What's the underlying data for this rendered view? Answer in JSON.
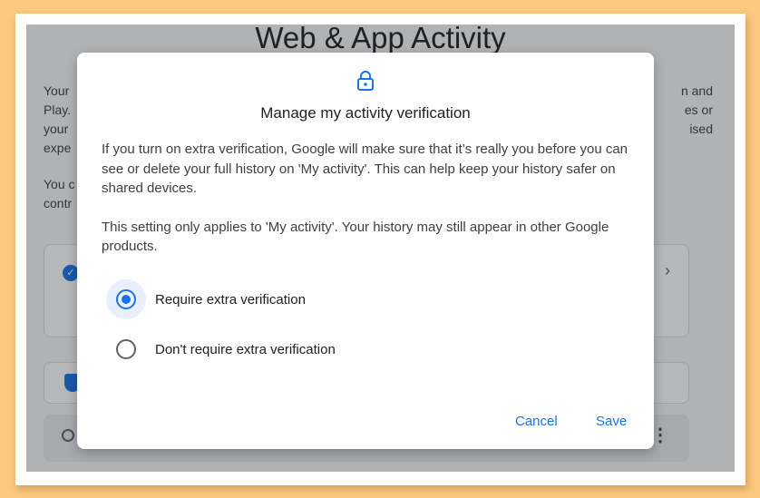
{
  "background_app": {
    "page_title": "Web & App Activity",
    "left_paragraph_1": "Your\nPlay.\nyour\nexpe",
    "left_paragraph_2": "You c\ncontr",
    "right_paragraph": "n and\nes or\nised"
  },
  "dialog": {
    "title": "Manage my activity verification",
    "paragraph_1": "If you turn on extra verification, Google will make sure that it’s really you before you can see or delete your full history on 'My activity'. This can help keep your history safer on shared devices.",
    "paragraph_2": "This setting only applies to 'My activity'. Your history may still appear in other Google products.",
    "options": [
      {
        "label": "Require extra verification",
        "selected": true
      },
      {
        "label": "Don't require extra verification",
        "selected": false
      }
    ],
    "cancel_label": "Cancel",
    "save_label": "Save"
  },
  "colors": {
    "accent": "#1a73e8",
    "outer_background": "#fbc97f"
  },
  "icons": {
    "dialog_icon": "lock-icon"
  }
}
